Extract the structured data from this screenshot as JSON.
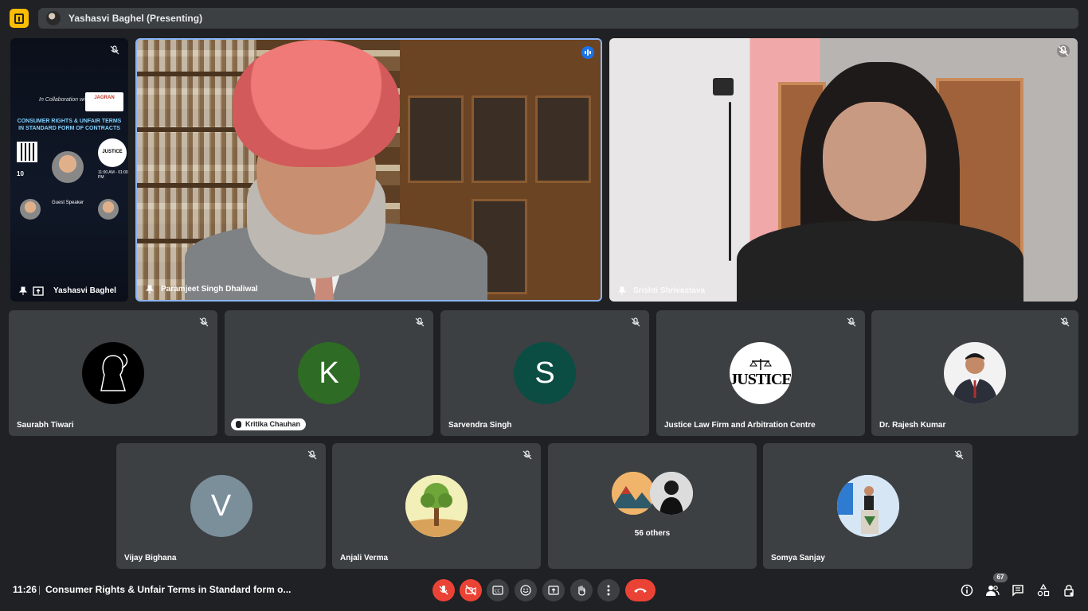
{
  "header": {
    "presenting_text": "Yashasvi Baghel (Presenting)"
  },
  "poster": {
    "title": "CONSUMER RIGHTS & UNFAIR TERMS IN STANDARD FORM OF CONTRACTS",
    "collab": "In Collaboration with",
    "brand": "JAGRAN",
    "sponsor_text": "JUSTICE",
    "guest_label": "Guest Speaker",
    "date": "10",
    "time": "11:00 AM - 01:00 PM"
  },
  "featured_tiles": [
    {
      "name": "Yashasvi Baghel"
    },
    {
      "name": "Paramjeet Singh Dhaliwal"
    },
    {
      "name": "Srishti Shrivastava"
    }
  ],
  "grid_row1": [
    {
      "name": "Saurabh Tiwari",
      "avatar": "reaper-avatar"
    },
    {
      "name": "Kritika Chauhan",
      "letter": "K",
      "color": "#2e6b24"
    },
    {
      "name": "Sarvendra Singh",
      "letter": "S",
      "color": "#0b4d43"
    },
    {
      "name": "Justice Law Firm and Arbitration Centre",
      "avatar_text": "JUSTICE"
    },
    {
      "name": "Dr. Rajesh Kumar",
      "avatar": "photo"
    }
  ],
  "grid_row2": [
    {
      "name": "Vijay Bighana",
      "letter": "V",
      "color": "#7b8f9b"
    },
    {
      "name": "Anjali Verma",
      "avatar": "tree-avatar"
    },
    {
      "name": "",
      "others": "56 others"
    },
    {
      "name": "Somya Sanjay",
      "avatar": "podium-photo"
    }
  ],
  "bottom": {
    "clock": "11:26",
    "separator": "|",
    "meeting_title": "Consumer Rights & Unfair Terms in Standard form o...",
    "participants_count": "67"
  },
  "colors": {
    "background": "#202124",
    "tile": "#3c4043",
    "accent_blue": "#1a73e8",
    "red": "#ea4335",
    "logo": "#fbbc04"
  }
}
